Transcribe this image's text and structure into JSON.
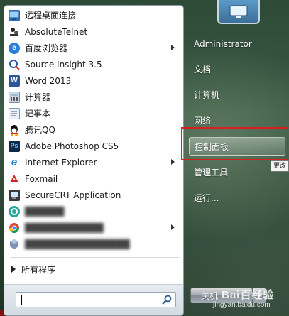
{
  "programs": [
    {
      "label": "远程桌面连接",
      "icon": "remote-desktop-icon",
      "has_submenu": false,
      "blurred": false
    },
    {
      "label": "AbsoluteTelnet",
      "icon": "absolutetelnet-icon",
      "has_submenu": false,
      "blurred": false
    },
    {
      "label": "百度浏览器",
      "icon": "baidu-browser-icon",
      "has_submenu": true,
      "blurred": false
    },
    {
      "label": "Source Insight 3.5",
      "icon": "source-insight-icon",
      "has_submenu": false,
      "blurred": false
    },
    {
      "label": "Word 2013",
      "icon": "word-icon",
      "has_submenu": false,
      "blurred": false
    },
    {
      "label": "计算器",
      "icon": "calculator-icon",
      "has_submenu": false,
      "blurred": false
    },
    {
      "label": "记事本",
      "icon": "notepad-icon",
      "has_submenu": false,
      "blurred": false
    },
    {
      "label": "腾讯QQ",
      "icon": "qq-icon",
      "has_submenu": false,
      "blurred": false
    },
    {
      "label": "Adobe Photoshop CS5",
      "icon": "photoshop-icon",
      "has_submenu": false,
      "blurred": false
    },
    {
      "label": "Internet Explorer",
      "icon": "internet-explorer-icon",
      "has_submenu": true,
      "blurred": false
    },
    {
      "label": "Foxmail",
      "icon": "foxmail-icon",
      "has_submenu": false,
      "blurred": false
    },
    {
      "label": "SecureCRT Application",
      "icon": "securecrt-icon",
      "has_submenu": false,
      "blurred": false
    },
    {
      "label": "",
      "icon": "green-app-icon",
      "has_submenu": false,
      "blurred": true
    },
    {
      "label": "",
      "icon": "chrome-icon",
      "has_submenu": true,
      "blurred": true
    },
    {
      "label": "",
      "icon": "virtualbox-icon",
      "has_submenu": false,
      "blurred": true
    }
  ],
  "all_programs_label": "所有程序",
  "search": {
    "value": "",
    "placeholder": ""
  },
  "right_panel": {
    "items": [
      {
        "label": "Administrator",
        "active": false
      },
      {
        "label": "文档",
        "active": false
      },
      {
        "label": "计算机",
        "active": false
      },
      {
        "label": "网络",
        "active": false
      },
      {
        "label": "控制面板",
        "active": true
      },
      {
        "label": "管理工具",
        "active": false
      },
      {
        "label": "运行...",
        "active": false
      }
    ],
    "tooltip_fragment": "更改",
    "shutdown_label": "关机"
  },
  "watermark": {
    "logo": "Bai百经验",
    "url": "jingyan.baidu.com"
  },
  "colors": {
    "highlight_border": "#d81e1e",
    "panel_bg": "#ffffff"
  }
}
